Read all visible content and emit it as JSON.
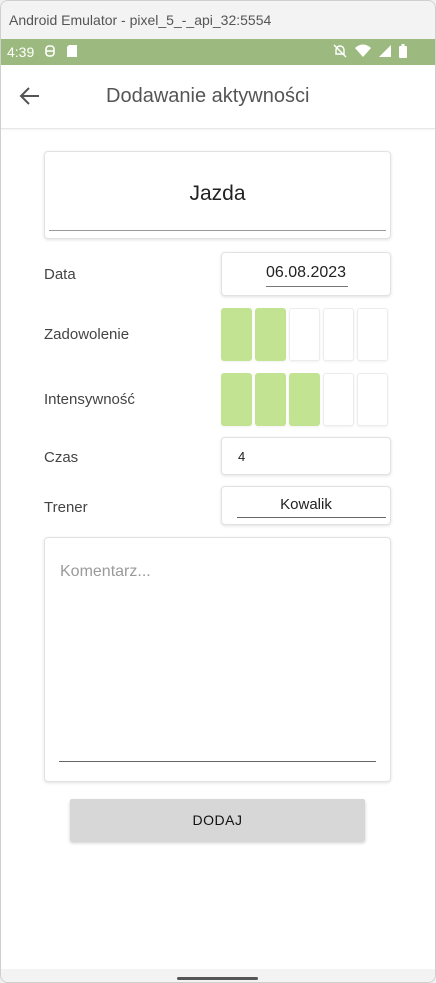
{
  "window": {
    "title": "Android Emulator - pixel_5_-_api_32:5554"
  },
  "status_bar": {
    "time": "4:39",
    "bg_color": "#9cba7f"
  },
  "app_bar": {
    "title": "Dodawanie aktywności"
  },
  "form": {
    "activity_name": "Jazda",
    "date_label": "Data",
    "date_value": "06.08.2023",
    "satisfaction_label": "Zadowolenie",
    "satisfaction_level": 2,
    "satisfaction_max": 5,
    "intensity_label": "Intensywność",
    "intensity_level": 3,
    "intensity_max": 5,
    "time_label": "Czas",
    "time_value": "4",
    "trainer_label": "Trener",
    "trainer_value": "Kowalik",
    "comment_placeholder": "Komentarz...",
    "submit_label": "DODAJ",
    "accent_color": "#c2e492"
  }
}
